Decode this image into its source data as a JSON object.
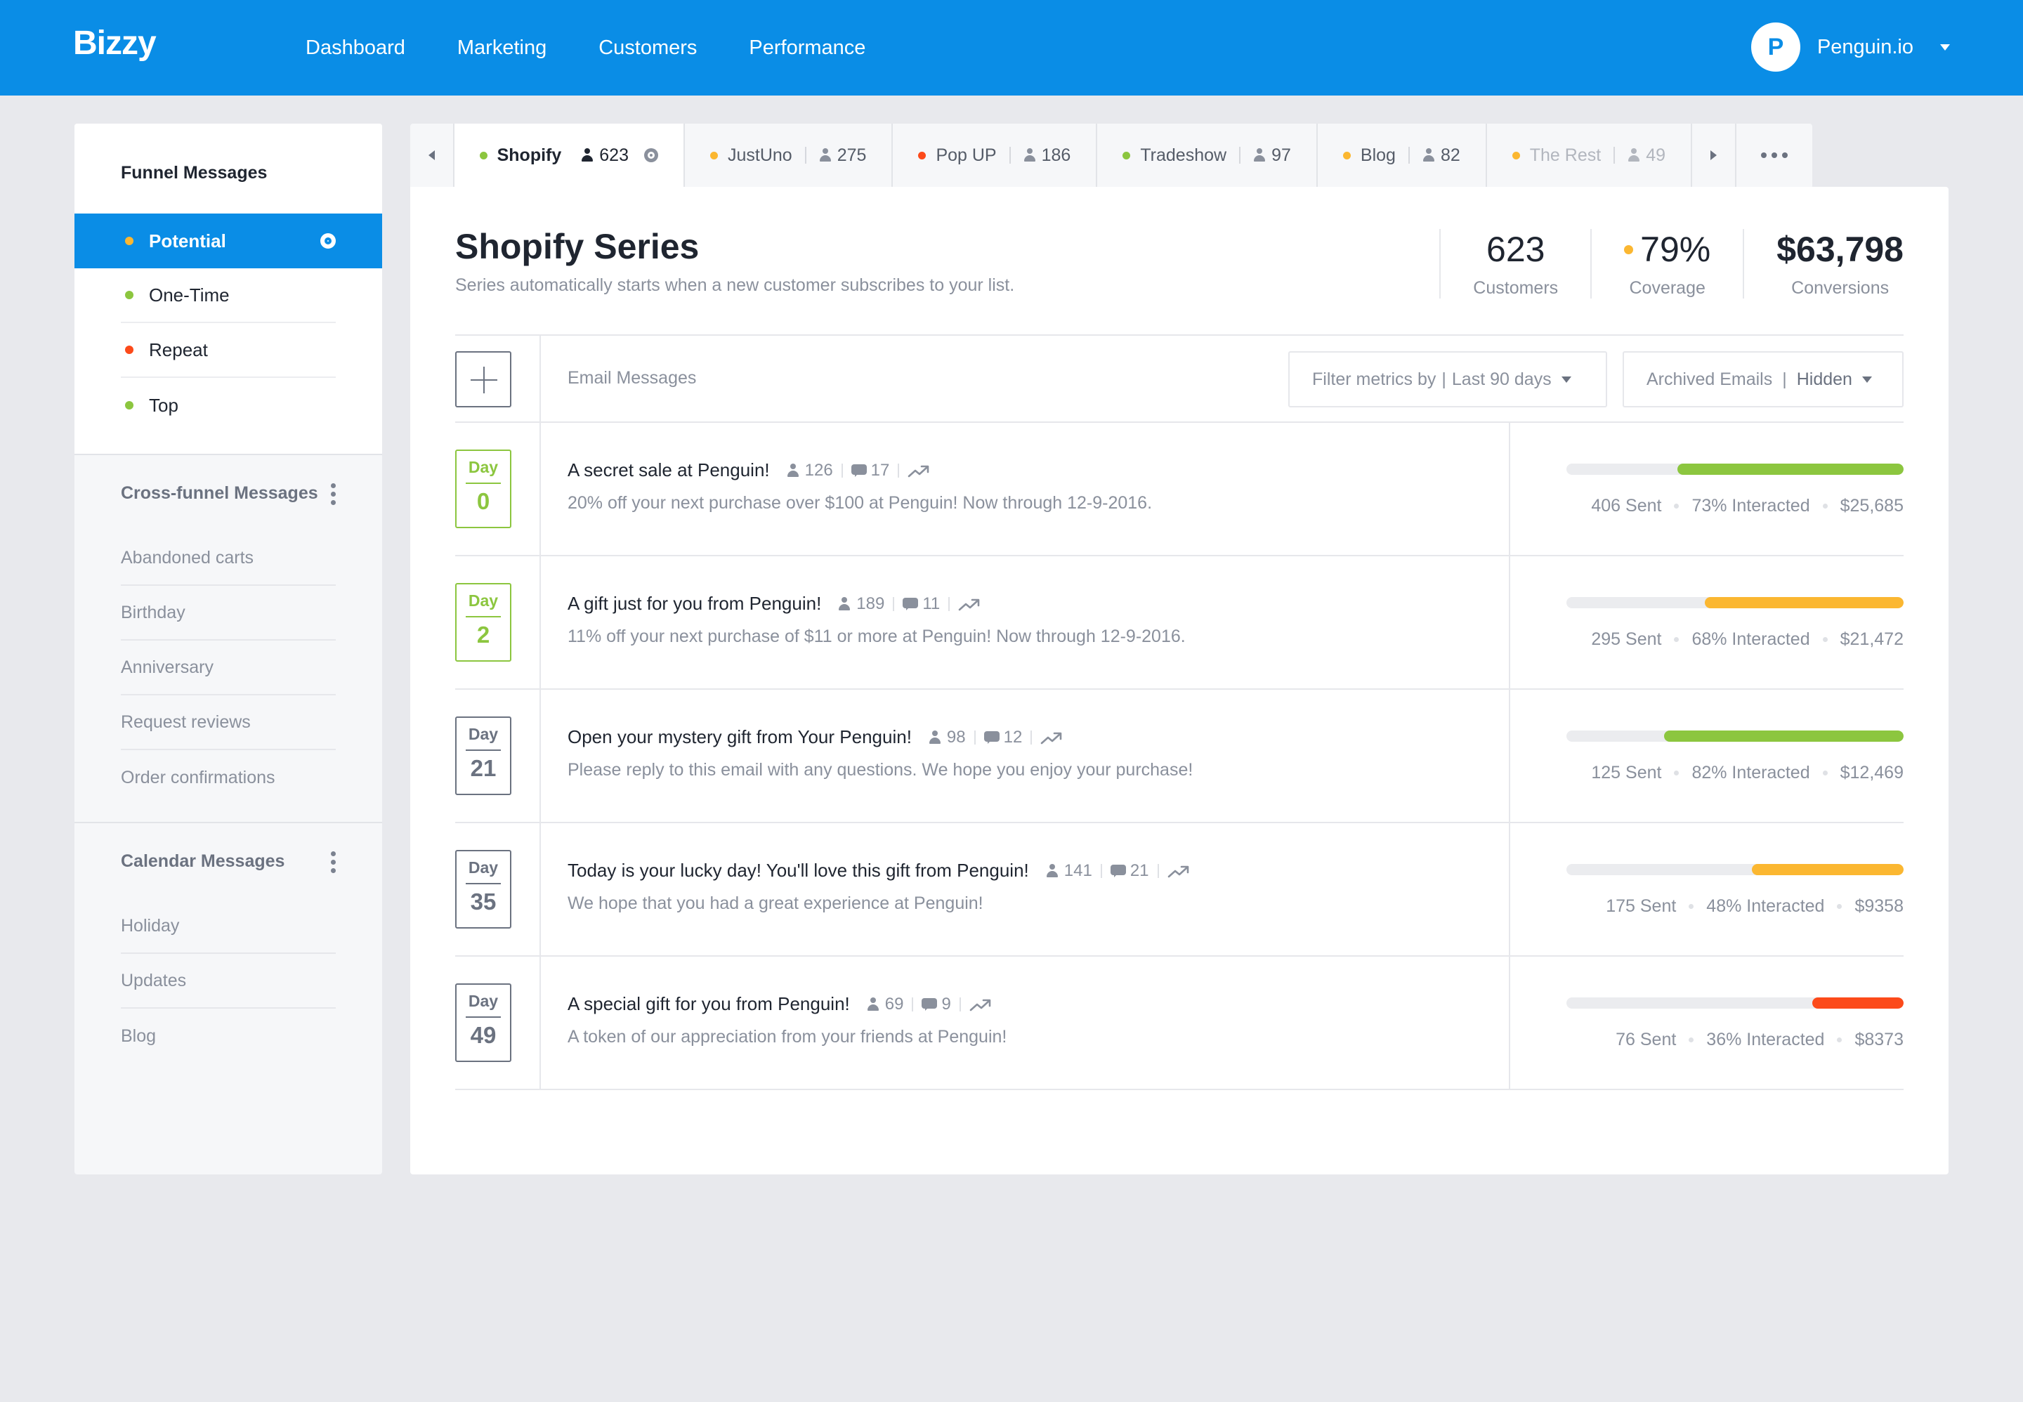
{
  "app": {
    "brand": "Bizzy",
    "nav": [
      "Dashboard",
      "Marketing",
      "Customers",
      "Performance"
    ],
    "account": {
      "initial": "P",
      "name": "Penguin.io"
    }
  },
  "colors": {
    "primary": "#0a8de6",
    "green": "#8cc63f",
    "yellow": "#fbb731",
    "red": "#fc4a1a"
  },
  "sidebar": {
    "funnel_title": "Funnel Messages",
    "funnel_items": [
      {
        "label": "Potential",
        "color": "#fbb731",
        "active": true
      },
      {
        "label": "One-Time",
        "color": "#8cc63f"
      },
      {
        "label": "Repeat",
        "color": "#fc4a1a"
      },
      {
        "label": "Top",
        "color": "#8cc63f"
      }
    ],
    "cross_funnel_title": "Cross-funnel Messages",
    "cross_funnel_items": [
      "Abandoned carts",
      "Birthday",
      "Anniversary",
      "Request reviews",
      "Order confirmations"
    ],
    "calendar_title": "Calendar Messages",
    "calendar_items": [
      "Holiday",
      "Updates",
      "Blog"
    ]
  },
  "tabs": [
    {
      "label": "Shopify",
      "count": "623",
      "color": "#8cc63f",
      "active": true
    },
    {
      "label": "JustUno",
      "count": "275",
      "color": "#fbb731"
    },
    {
      "label": "Pop UP",
      "count": "186",
      "color": "#fc4a1a"
    },
    {
      "label": "Tradeshow",
      "count": "97",
      "color": "#8cc63f"
    },
    {
      "label": "Blog",
      "count": "82",
      "color": "#fbb731"
    },
    {
      "label": "The Rest",
      "count": "49",
      "color": "#fbb731",
      "faded": true
    }
  ],
  "series": {
    "title": "Shopify Series",
    "subtitle": "Series automatically starts when a new customer subscribes to your list.",
    "stats": [
      {
        "value": "623",
        "label": "Customers"
      },
      {
        "value": "79%",
        "label": "Coverage",
        "dot": "#fbb731"
      },
      {
        "value": "$63,798",
        "label": "Conversions"
      }
    ]
  },
  "toolbar": {
    "email_label": "Email Messages",
    "filter_prefix": "Filter metrics by",
    "filter_value": "Last 90 days",
    "archived_label": "Archived Emails",
    "archived_value": "Hidden"
  },
  "messages": [
    {
      "day_label": "Day",
      "day": "0",
      "badge": "green",
      "title": "A secret sale at Penguin!",
      "people": "126",
      "comments": "17",
      "desc": "20% off your next purchase over $100 at Penguin! Now through 12-9-2016.",
      "progress": 0.67,
      "bar_color": "#8cc63f",
      "sent": "406 Sent",
      "interacted": "73% Interacted",
      "revenue": "$25,685"
    },
    {
      "day_label": "Day",
      "day": "2",
      "badge": "green",
      "title": "A gift just for you from Penguin!",
      "people": "189",
      "comments": "11",
      "desc": "11% off your next purchase of $11 or more at Penguin! Now through 12-9-2016.",
      "progress": 0.59,
      "bar_color": "#fbb731",
      "sent": "295 Sent",
      "interacted": "68% Interacted",
      "revenue": "$21,472"
    },
    {
      "day_label": "Day",
      "day": "21",
      "badge": "grey",
      "title": "Open your mystery gift from Your Penguin!",
      "people": "98",
      "comments": "12",
      "desc": "Please reply to this email with any questions. We hope you enjoy your purchase!",
      "progress": 0.71,
      "bar_color": "#8cc63f",
      "sent": "125 Sent",
      "interacted": "82% Interacted",
      "revenue": "$12,469"
    },
    {
      "day_label": "Day",
      "day": "35",
      "badge": "grey",
      "title": "Today is your lucky day! You'll love this gift from Penguin!",
      "people": "141",
      "comments": "21",
      "desc": "We hope that you had a great experience at Penguin!",
      "progress": 0.45,
      "bar_color": "#fbb731",
      "sent": "175 Sent",
      "interacted": "48% Interacted",
      "revenue": "$9358"
    },
    {
      "day_label": "Day",
      "day": "49",
      "badge": "grey",
      "title": "A special gift for you from Penguin!",
      "people": "69",
      "comments": "9",
      "desc": "A token of our appreciation from your friends at Penguin!",
      "progress": 0.27,
      "bar_color": "#fc4a1a",
      "sent": "76 Sent",
      "interacted": "36% Interacted",
      "revenue": "$8373"
    }
  ]
}
